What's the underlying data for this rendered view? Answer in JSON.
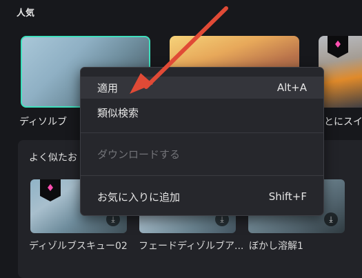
{
  "popular": {
    "title": "人気",
    "items": [
      {
        "label": "ディソルブ"
      },
      {
        "label": ""
      },
      {
        "label": "とにスイン"
      }
    ]
  },
  "similar": {
    "title": "よく似たお",
    "items": [
      {
        "label": "ディゾルブスキュー02"
      },
      {
        "label": "フェードディゾルブア..."
      },
      {
        "label": "ぼかし溶解1"
      }
    ]
  },
  "context_menu": {
    "items": [
      {
        "label": "適用",
        "shortcut": "Alt+A",
        "highlighted": true,
        "enabled": true
      },
      {
        "label": "類似検索",
        "shortcut": "",
        "enabled": true
      },
      {
        "label": "ダウンロードする",
        "shortcut": "",
        "enabled": false
      },
      {
        "label": "お気に入りに追加",
        "shortcut": "Shift+F",
        "enabled": true
      }
    ]
  },
  "icons": {
    "premium": "gem-icon",
    "download": "download-icon",
    "annotation": "red-arrow"
  },
  "colors": {
    "selected_border": "#3fe0bd",
    "premium_gem": "#ff4fb0",
    "annotation_arrow": "#e04a36"
  }
}
